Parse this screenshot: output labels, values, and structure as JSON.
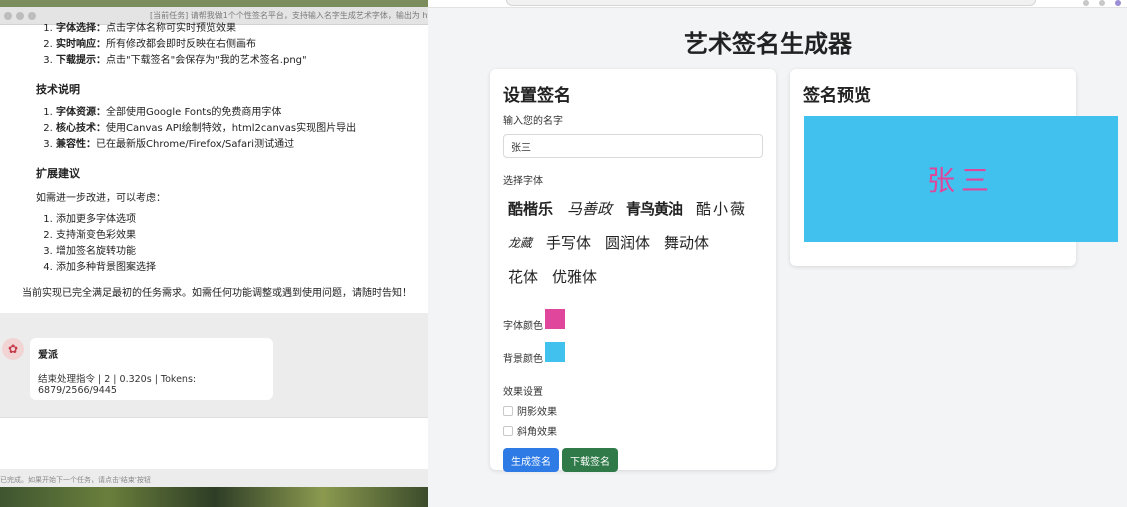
{
  "chat": {
    "window_title": "[当前任务] 请帮我做1个个性签名平台，支持输入名字生成艺术字体，输出为 html",
    "top_items": [
      {
        "bold": "字体选择：",
        "text": "点击字体名称可实时预览效果"
      },
      {
        "bold": "实时响应：",
        "text": "所有修改都会即时反映在右侧画布"
      },
      {
        "bold": "下载提示：",
        "text": "点击\"下载签名\"会保存为\"我的艺术签名.png\""
      }
    ],
    "tech_heading": "技术说明",
    "tech_items": [
      {
        "bold": "字体资源：",
        "text": "全部使用Google Fonts的免费商用字体"
      },
      {
        "bold": "核心技术：",
        "text": "使用Canvas API绘制特效，html2canvas实现图片导出"
      },
      {
        "bold": "兼容性：",
        "text": "已在最新版Chrome/Firefox/Safari测试通过"
      }
    ],
    "ext_heading": "扩展建议",
    "ext_intro": "如需进一步改进，可以考虑：",
    "ext_items": [
      "添加更多字体选项",
      "支持渐变色彩效果",
      "增加签名旋转功能",
      "添加多种背景图案选择"
    ],
    "closing": "当前实现已完全满足最初的任务需求。如需任何功能调整或遇到使用问题，请随时告知！",
    "reply_name": "爱派",
    "reply_status": "结束处理指令 | 2 | 0.320s | Tokens: 6879/2566/9445",
    "hint": "已完成。如果开始下一个任务，请点击'结束'按钮"
  },
  "app": {
    "title": "艺术签名生成器",
    "settings": {
      "heading": "设置签名",
      "name_label": "输入您的名字",
      "name_value": "张三",
      "font_label": "选择字体",
      "fonts": [
        "酷楷乐",
        "马善政",
        "青鸟黄油",
        "酷小薇",
        "龙藏",
        "手写体",
        "圆润体",
        "舞动体",
        "花体",
        "优雅体"
      ],
      "text_color_label": "字体颜色",
      "text_color": "#e0469c",
      "bg_color_label": "背景颜色",
      "bg_color": "#41c2ee",
      "effects_label": "效果设置",
      "shadow_label": "阴影效果",
      "bevel_label": "斜角效果",
      "generate_label": "生成签名",
      "download_label": "下载签名"
    },
    "preview": {
      "heading": "签名预览",
      "text": "张三"
    }
  }
}
